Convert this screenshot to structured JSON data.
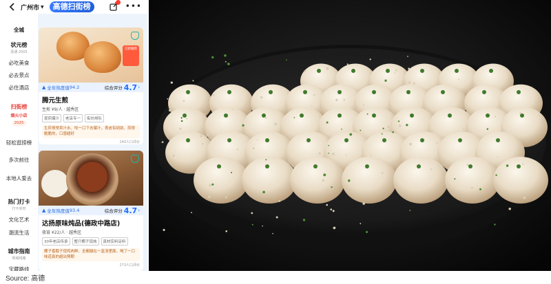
{
  "app": {
    "city": "广州市",
    "brand": "高德扫街榜"
  },
  "sidebar": {
    "scope": "全城",
    "items": [
      {
        "label": "状元榜",
        "sub": "喜通 2005"
      },
      {
        "label": "必吃美食"
      },
      {
        "label": "必去景点"
      },
      {
        "label": "必住酒店"
      },
      {
        "label": "扫街榜",
        "sub": "烟火小店",
        "pill": "2025"
      },
      {
        "label": "轻松逛捞榜"
      },
      {
        "label": "多次前往"
      },
      {
        "label": "本地人爱去"
      },
      {
        "label": "热门打卡",
        "sub": "打卡实时"
      },
      {
        "label": "文化艺术"
      },
      {
        "label": "潮流生活"
      },
      {
        "label": "城市指南",
        "sub": "地域线路"
      },
      {
        "label": "宝藏路线"
      }
    ]
  },
  "cards": [
    {
      "heat_label": "全年热度值",
      "heat_value": "94.2",
      "score_label": "综合评分",
      "score": "4.7",
      "title": "腾元生煎",
      "meta": "生煎 ¥9/人 · 越秀区",
      "tags": [
        "现煎爆汁",
        "老店专一",
        "街坊排队"
      ],
      "quote": "生煎哥常卖汁水、咬一口下去爆汁，表皮有韧劲、煎得脆脆的，口感超好",
      "reviews": "240人口评价",
      "promo": "已获推荐"
    },
    {
      "heat_label": "全年热度值",
      "heat_value": "93.4",
      "score_label": "综合评分",
      "score": "4.7",
      "title": "达扬原味炖品(德政中路店)",
      "meta": "夜宵 ¥22/人 · 越秀区",
      "tags": [
        "30年老店传承",
        "整只椰子现炖",
        "真材实料足料"
      ],
      "quote": "椰子香醇子现鸡肉鲜、全都融在一盅汤里面，喝了一口味道真的超出预期",
      "reviews": "273人口评价"
    }
  ],
  "caption": "Source:  高德",
  "colors": {
    "accent": "#1f6fff",
    "hot": "#e8413a",
    "quote_text": "#b8631c"
  },
  "icons": [
    "back-icon",
    "share-icon",
    "more-icon",
    "shield-icon",
    "flame-icon",
    "chevron-right-icon"
  ]
}
